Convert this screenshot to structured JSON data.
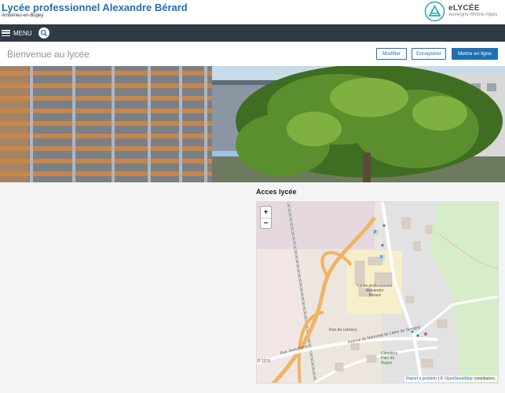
{
  "header": {
    "title": "Lycée professionnel Alexandre Bérard",
    "subtitle": "Ambérieu-en-Bugey",
    "brand_name": "eLYCÉE",
    "brand_region": "Auvergne-Rhône-Alpes"
  },
  "nav": {
    "menu_label": "MENU"
  },
  "toolbar": {
    "welcome": "Bienvenue au lycée",
    "modify": "Modifier",
    "save": "Enregistrer",
    "publish": "Mettre en ligne"
  },
  "map": {
    "title": "Acces lycée",
    "zoom_in": "+",
    "zoom_out": "−",
    "attribution_report": "Report a problem",
    "attribution_sep": "| ©",
    "attribution_osm": "OpenStreetMap",
    "attribution_tail": "contributors.",
    "labels": {
      "school": "Lycée professionnel\nAlexandre\nBérard",
      "street1": "Rue de Lebreux",
      "street2": "Avenue du Maréchal de Lattre de Tassigny",
      "street3": "Rue Jean-Pierre",
      "road": "D 1075",
      "poi": "Cimetière\nParc de\nBugey",
      "parking": "P"
    }
  },
  "colors": {
    "brand_blue": "#1f6fb4",
    "navbar": "#2f3a45"
  }
}
